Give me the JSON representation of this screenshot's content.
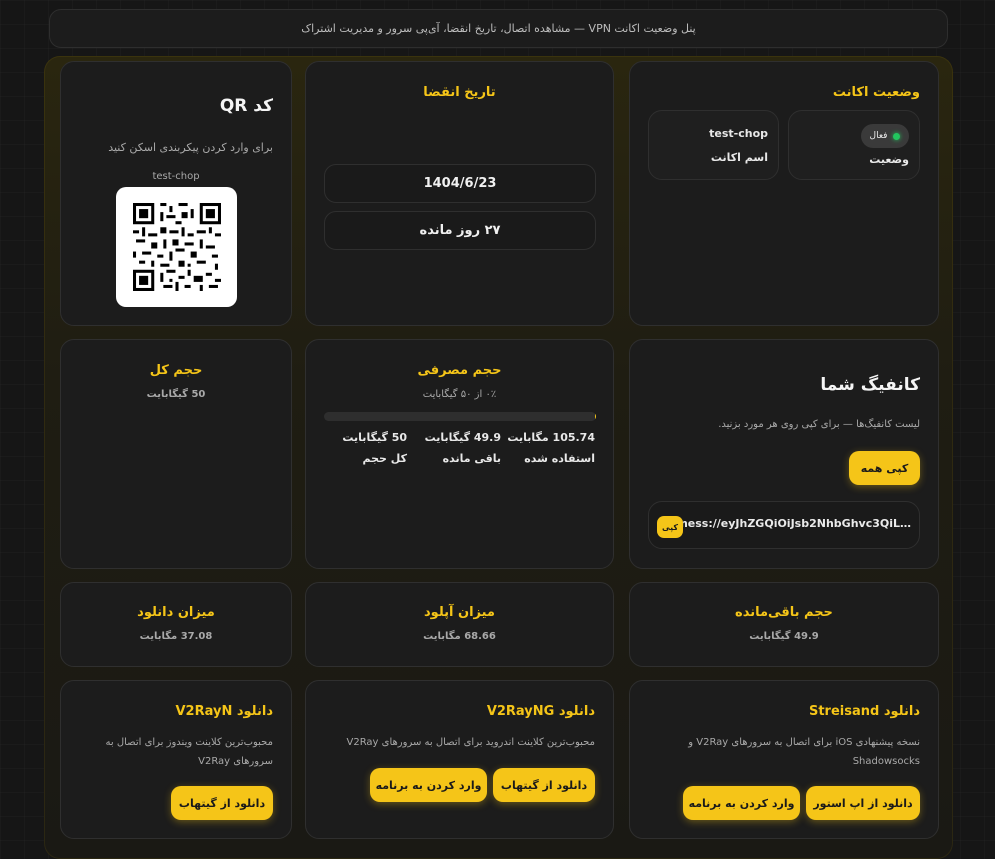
{
  "header": {
    "subtitle": "پنل وضعیت اکانت VPN — مشاهده اتصال، تاریخ انقضا، آی‌پی سرور و مدیریت اشتراک"
  },
  "account": {
    "title": "وضعیت اکانت",
    "status_badge": "فعال",
    "status_label": "وضعیت",
    "name_value": "test-chop",
    "name_label": "اسم اکانت"
  },
  "expiry": {
    "title": "تاریخ انقضا",
    "date": "1404/6/23",
    "days_left": "۲۷ روز مانده"
  },
  "qr": {
    "title": "کد QR",
    "hint": "برای وارد کردن پیکربندی اسکن کنید",
    "name": "test-chop"
  },
  "config": {
    "title": "کانفیگ شما",
    "hint": "لیست کانفیگ‌ها — برای کپی روی هر مورد بزنید.",
    "copy_all": "کپی همه",
    "item_text": "vmess://eyJhZGQiOiJsb2NhbGhvc3QiL…",
    "item_copy": "کپی"
  },
  "usage": {
    "title": "حجم مصرفی",
    "percent_text": "۰٪ از ۵۰ گیگابایت",
    "progress": 0.002,
    "used_value": "105.74 مگابایت",
    "used_label": "استفاده شده",
    "remain_value": "49.9 گیگابایت",
    "remain_label": "باقی مانده",
    "total_value": "50 گیگابایت",
    "total_label": "کل حجم"
  },
  "total": {
    "title": "حجم کل",
    "value": "50 گیگابایت"
  },
  "remaining": {
    "title": "حجم باقی‌مانده",
    "value": "49.9 گیگابایت"
  },
  "upload": {
    "title": "میزان آپلود",
    "value": "68.66 مگابایت"
  },
  "download": {
    "title": "میزان دانلود",
    "value": "37.08 مگابایت"
  },
  "streisand": {
    "title": "دانلود Streisand",
    "desc": "نسخه پیشنهادی iOS برای اتصال به سرورهای V2Ray و Shadowsocks",
    "btn_store": "دانلود از اپ استور",
    "btn_import": "وارد کردن به برنامه"
  },
  "v2rayng": {
    "title": "دانلود V2RayNG",
    "desc": "محبوب‌ترین کلاینت اندروید برای اتصال به سرورهای V2Ray",
    "btn_github": "دانلود از گیتهاب",
    "btn_import": "وارد کردن به برنامه"
  },
  "v2rayn": {
    "title": "دانلود V2RayN",
    "desc": "محبوب‌ترین کلاینت ویندوز برای اتصال به سرورهای V2Ray",
    "btn_github": "دانلود از گیتهاب"
  },
  "colors": {
    "accent": "#f5c518",
    "status": "#22c55e"
  }
}
